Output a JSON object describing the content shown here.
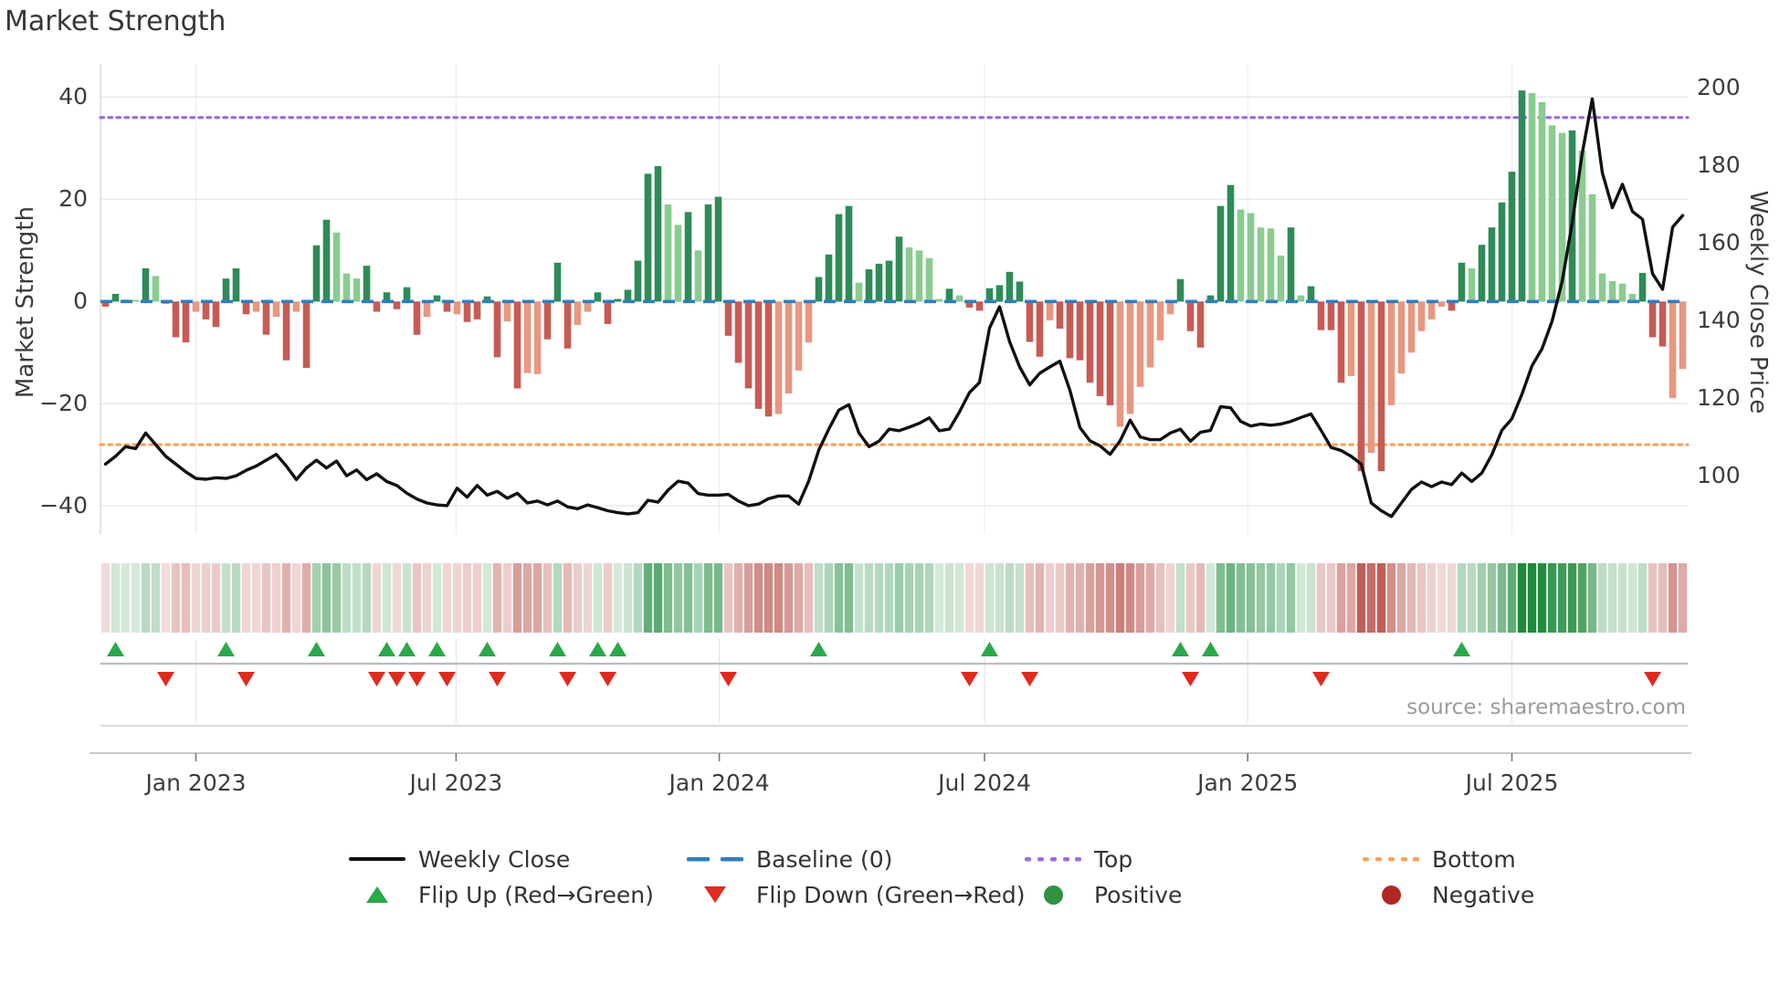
{
  "title": "Market Strength",
  "source_note": "source: sharemaestro.com",
  "axes": {
    "left_title": "Market Strength",
    "right_title": "Weekly Close Price",
    "left_ticks": [
      {
        "label": "40",
        "value": 40
      },
      {
        "label": "20",
        "value": 20
      },
      {
        "label": "0",
        "value": 0
      },
      {
        "label": "−20",
        "value": -20
      },
      {
        "label": "−40",
        "value": -40
      }
    ],
    "right_ticks": [
      {
        "label": "200",
        "value": 200
      },
      {
        "label": "180",
        "value": 180
      },
      {
        "label": "160",
        "value": 160
      },
      {
        "label": "140",
        "value": 140
      },
      {
        "label": "120",
        "value": 120
      },
      {
        "label": "100",
        "value": 100
      }
    ],
    "x_ticks": [
      {
        "label": "Jan 2023",
        "week": 9
      },
      {
        "label": "Jul 2023",
        "week": 34.9
      },
      {
        "label": "Jan 2024",
        "week": 61.1
      },
      {
        "label": "Jul 2024",
        "week": 87.5
      },
      {
        "label": "Jan 2025",
        "week": 113.7
      },
      {
        "label": "Jul 2025",
        "week": 140
      }
    ]
  },
  "legend": {
    "items": [
      {
        "label": "Weekly Close"
      },
      {
        "label": "Baseline (0)"
      },
      {
        "label": "Top"
      },
      {
        "label": "Bottom"
      },
      {
        "label": "Flip Up (Red→Green)"
      },
      {
        "label": "Flip Down (Green→Red)"
      },
      {
        "label": "Positive"
      },
      {
        "label": "Negative"
      }
    ]
  },
  "colors": {
    "bar_dark_green": "#2e8b57",
    "bar_light_green": "#8bcb90",
    "bar_dark_red": "#c75b54",
    "bar_light_red": "#e89780",
    "baseline_blue": "#2f7fbf",
    "top_purple": "#9d6be0",
    "bottom_orange": "#f5a45a",
    "line_black": "#111111",
    "flip_up_green": "#2aa84a",
    "flip_down_red": "#df2b1e",
    "positive_green": "#2f9242",
    "negative_red": "#b02822",
    "heat_green": "#1e8a3c",
    "heat_red": "#b5453c",
    "grid": "#e7e7ee"
  },
  "chart_data": {
    "type": "combo",
    "description": "Weekly market-strength bars (left axis) with weekly close price line (right axis), heatmap strip of strength, and flip up/down markers. Weekly data Nov 2022 - Oct 2025.",
    "x_unit": "week",
    "left_ylim": [
      -45.5,
      46.5
    ],
    "right_ylim": [
      85,
      206
    ],
    "baseline": 0,
    "top_line": 36,
    "bottom_line": -28,
    "strength_values": [
      -1,
      1.5,
      0.4,
      0.3,
      6.5,
      5,
      -0.5,
      -7,
      -8,
      -2,
      -3.5,
      -5,
      4.5,
      6.5,
      -2.5,
      -2,
      -6.5,
      -3,
      -11.5,
      -2,
      -13,
      11,
      16,
      13.5,
      5.5,
      4.5,
      7,
      -2,
      1.8,
      -1.5,
      2.8,
      -6.5,
      -3,
      1.2,
      -2,
      -2.5,
      -4,
      -3.5,
      1,
      -10.9,
      -3.9,
      -17,
      -14,
      -14.2,
      -7.4,
      7.6,
      -9.2,
      -4.6,
      -2,
      1.8,
      -4.4,
      0.5,
      2.3,
      8,
      25,
      26.5,
      19,
      15,
      17.5,
      10,
      19,
      20.5,
      -6.7,
      -12,
      -17,
      -21,
      -22.5,
      -22,
      -18,
      -13.5,
      -8,
      4.8,
      9.2,
      17.1,
      18.7,
      3.7,
      6.3,
      7.4,
      8,
      12.7,
      10.6,
      10,
      8.5,
      0.5,
      2.5,
      1.2,
      -1.2,
      -1.8,
      2.6,
      3.2,
      5.8,
      3.9,
      -7.9,
      -10.8,
      -3.7,
      -5.3,
      -11.1,
      -11.5,
      -15.9,
      -18.5,
      -20.3,
      -24.5,
      -22,
      -16.7,
      -12.9,
      -7.6,
      -2.5,
      4.4,
      -5.8,
      -9,
      1.2,
      18.7,
      22.8,
      18,
      17.3,
      14.5,
      14.3,
      9,
      14.5,
      1.2,
      3,
      -5.6,
      -5.6,
      -15.9,
      -14.6,
      -33.2,
      -29.6,
      -33.2,
      -20.3,
      -14.1,
      -10,
      -5.8,
      -3.5,
      -1,
      -1.8,
      7.6,
      6.5,
      11.1,
      14.5,
      19.4,
      25.4,
      41.3,
      40.8,
      39,
      34.5,
      33,
      33.5,
      29.5,
      21,
      5.5,
      4,
      3.5,
      1.5,
      5.6,
      -7,
      -8.8,
      -18.9,
      -13.2
    ],
    "strength_shades": [
      "dr",
      "dg",
      "lg",
      "lg",
      "dg",
      "lg",
      "lr",
      "dr",
      "dr",
      "lr",
      "dr",
      "dr",
      "dg",
      "dg",
      "dr",
      "lr",
      "dr",
      "lr",
      "dr",
      "lr",
      "dr",
      "dg",
      "dg",
      "lg",
      "lg",
      "lg",
      "dg",
      "dr",
      "dg",
      "dr",
      "dg",
      "dr",
      "lr",
      "dg",
      "dr",
      "lr",
      "dr",
      "dr",
      "dg",
      "dr",
      "lr",
      "dr",
      "lr",
      "lr",
      "dr",
      "dg",
      "dr",
      "lr",
      "lr",
      "dg",
      "dr",
      "dg",
      "dg",
      "dg",
      "dg",
      "dg",
      "lg",
      "lg",
      "dg",
      "lg",
      "dg",
      "dg",
      "dr",
      "dr",
      "dr",
      "dr",
      "dr",
      "lr",
      "lr",
      "lr",
      "lr",
      "dg",
      "dg",
      "dg",
      "dg",
      "lg",
      "dg",
      "dg",
      "dg",
      "dg",
      "lg",
      "lg",
      "lg",
      "lg",
      "dg",
      "lg",
      "dr",
      "dr",
      "dg",
      "dg",
      "dg",
      "dg",
      "dr",
      "dr",
      "lr",
      "dr",
      "dr",
      "dr",
      "dr",
      "dr",
      "dr",
      "lr",
      "lr",
      "lr",
      "lr",
      "lr",
      "lr",
      "dg",
      "dr",
      "dr",
      "dg",
      "dg",
      "dg",
      "lg",
      "lg",
      "lg",
      "lg",
      "lg",
      "dg",
      "lg",
      "dg",
      "dr",
      "dr",
      "dr",
      "lr",
      "dr",
      "lr",
      "dr",
      "lr",
      "lr",
      "lr",
      "lr",
      "lr",
      "lr",
      "dr",
      "dg",
      "lg",
      "dg",
      "dg",
      "dg",
      "dg",
      "dg",
      "lg",
      "lg",
      "lg",
      "lg",
      "dg",
      "lg",
      "lg",
      "lg",
      "lg",
      "lg",
      "lg",
      "dg",
      "dr",
      "dr",
      "lr",
      "lr"
    ],
    "weekly_close": [
      103,
      105,
      107.5,
      107,
      111,
      108,
      105,
      103,
      101,
      99.3,
      99.1,
      99.5,
      99.3,
      100,
      101.4,
      102.5,
      104,
      105.5,
      102.5,
      99,
      102,
      104,
      102,
      103.8,
      100,
      101.5,
      99,
      100.5,
      98.5,
      97.5,
      95.5,
      94,
      93,
      92.5,
      92.3,
      96.8,
      94.5,
      97.5,
      95,
      96,
      94.2,
      95.5,
      93,
      93.5,
      92.5,
      93.5,
      92,
      91.5,
      92.5,
      91.8,
      91,
      90.5,
      90.2,
      90.5,
      93.7,
      93.2,
      96.3,
      98.6,
      98.1,
      95.4,
      95,
      95,
      95.2,
      93.5,
      92.3,
      92.7,
      94.1,
      94.8,
      94.8,
      92.7,
      98.6,
      106.6,
      112,
      116.9,
      118.3,
      111,
      107.5,
      108.9,
      112,
      111.6,
      112.5,
      113.5,
      114.9,
      111.6,
      112,
      116.4,
      121.4,
      124,
      138,
      143.5,
      134.5,
      128,
      123.4,
      126.4,
      128,
      129.5,
      122,
      112.4,
      109,
      107.7,
      105.5,
      109,
      114.3,
      110,
      109.3,
      109.3,
      111,
      112,
      108.9,
      111.2,
      111.7,
      117.8,
      117.5,
      114,
      112.8,
      113.3,
      113,
      113.3,
      114,
      115,
      115.9,
      111.7,
      107.3,
      106.5,
      105,
      103,
      93,
      91,
      89.5,
      93,
      96.5,
      98.4,
      97.2,
      98.4,
      97.7,
      100.7,
      98.5,
      100.7,
      105.4,
      111.7,
      114.7,
      121,
      128.3,
      132.7,
      139.8,
      150,
      165,
      183,
      197,
      178,
      169,
      175,
      168,
      166,
      152,
      148,
      164,
      167
    ],
    "flip_up_weeks": [
      1,
      12,
      21,
      28,
      30,
      33,
      38,
      45,
      49,
      51,
      71,
      88,
      107,
      110,
      135
    ],
    "flip_down_weeks": [
      6,
      14,
      27,
      29,
      31,
      34,
      39,
      46,
      50,
      62,
      86,
      92,
      108,
      121,
      154
    ]
  }
}
